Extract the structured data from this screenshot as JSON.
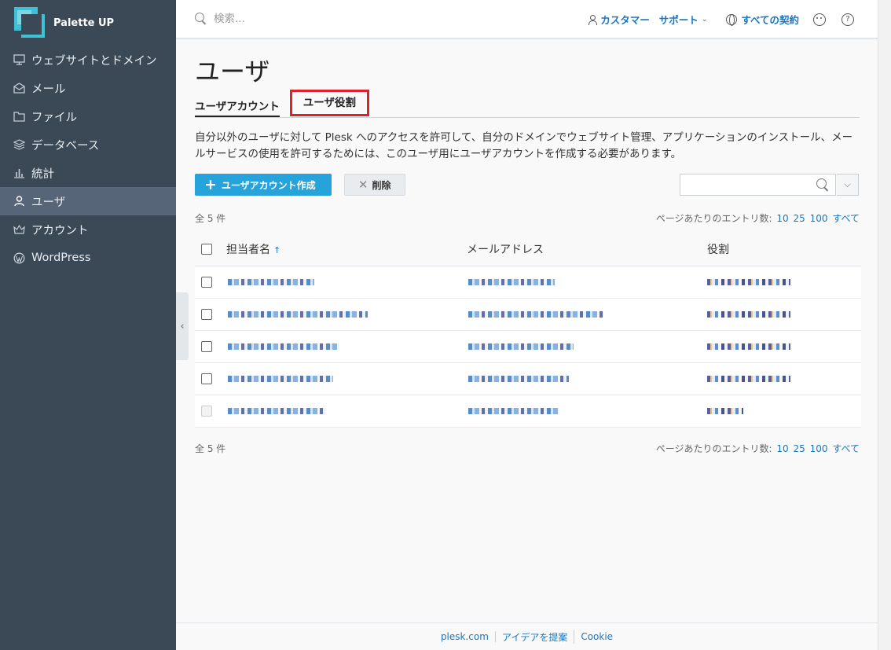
{
  "brand": {
    "name": "Palette UP"
  },
  "sidebar": {
    "items": [
      {
        "label": "ウェブサイトとドメイン",
        "icon": "monitor-icon"
      },
      {
        "label": "メール",
        "icon": "mail-icon"
      },
      {
        "label": "ファイル",
        "icon": "folder-icon"
      },
      {
        "label": "データベース",
        "icon": "database-icon"
      },
      {
        "label": "統計",
        "icon": "bar-chart-icon"
      },
      {
        "label": "ユーザ",
        "icon": "user-icon",
        "active": true
      },
      {
        "label": "アカウント",
        "icon": "crown-icon"
      },
      {
        "label": "WordPress",
        "icon": "wordpress-icon"
      }
    ]
  },
  "topbar": {
    "search_placeholder": "検索...",
    "user_label": "カスタマー",
    "support_label": "サポート",
    "subscriptions_label": "すべての契約"
  },
  "page": {
    "title": "ユーザ",
    "tabs": [
      {
        "label": "ユーザアカウント",
        "active": true
      },
      {
        "label": "ユーザ役割",
        "active": false,
        "highlighted": true
      }
    ],
    "description": "自分以外のユーザに対して Plesk へのアクセスを許可して、自分のドメインでウェブサイト管理、アプリケーションのインストール、メールサービスの使用を許可するためには、このユーザ用にユーザアカウントを作成する必要があります。",
    "create_button": "ユーザアカウント作成",
    "delete_button": "削除",
    "total_label": "全 5 件",
    "per_page_label": "ページあたりのエントリ数:",
    "per_page_options": [
      "10",
      "25",
      "100",
      "すべて"
    ]
  },
  "table": {
    "headers": {
      "name": "担当者名",
      "email": "メールアドレス",
      "role": "役割"
    },
    "rows": [
      {
        "name_w": 110,
        "email_w": 110,
        "role_w": 106,
        "disabled": false
      },
      {
        "name_w": 178,
        "email_w": 172,
        "role_w": 106,
        "disabled": false
      },
      {
        "name_w": 142,
        "email_w": 134,
        "role_w": 106,
        "disabled": false
      },
      {
        "name_w": 134,
        "email_w": 128,
        "role_w": 106,
        "disabled": false
      },
      {
        "name_w": 124,
        "email_w": 116,
        "role_w": 46,
        "disabled": true
      }
    ]
  },
  "footer": {
    "links": [
      "plesk.com",
      "アイデアを提案",
      "Cookie"
    ]
  },
  "colors": {
    "sidebar_bg": "#3b4856",
    "accent": "#27a3dc",
    "link": "#1a76bf",
    "highlight": "#e0202a"
  }
}
